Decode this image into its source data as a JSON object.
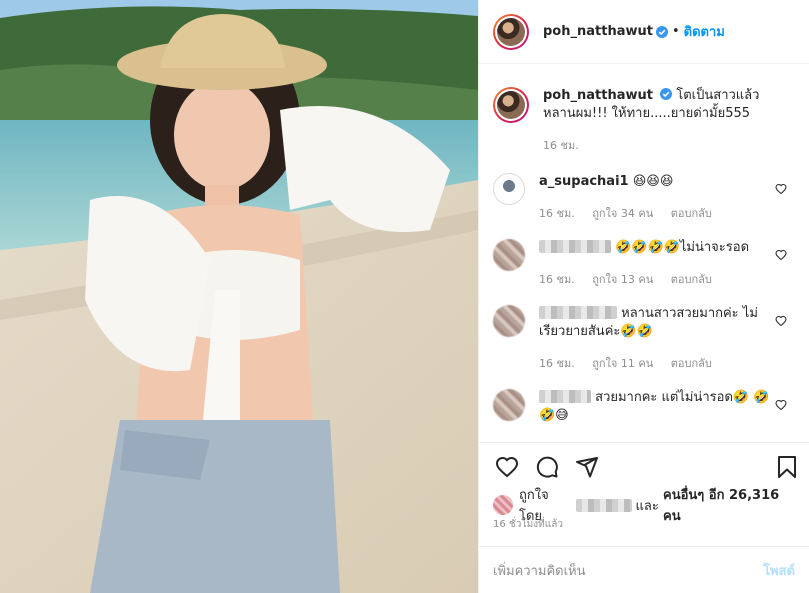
{
  "header": {
    "username": "poh_natthawut",
    "follow_label": "ติดตาม",
    "separator": "•"
  },
  "caption": {
    "username": "poh_natthawut",
    "text": "โตเป็นสาวแล้วหลานผม!!! ให้ทาย.....ยายด่ามั้ย555",
    "time": "16 ชม."
  },
  "comments": [
    {
      "username": "a_supachai1",
      "text": "😆😆😆",
      "time": "16 ชม.",
      "likes": "ถูกใจ 34 คน",
      "reply": "ตอบกลับ"
    },
    {
      "username": "",
      "text": "🤣🤣🤣🤣ไม่น่าจะรอด",
      "time": "16 ชม.",
      "likes": "ถูกใจ 13 คน",
      "reply": "ตอบกลับ"
    },
    {
      "username": "",
      "text": "หลานสาวสวยมากค่ะ ไม่เรียวยายสันค่ะ🤣🤣",
      "time": "16 ชม.",
      "likes": "ถูกใจ 11 คน",
      "reply": "ตอบกลับ"
    },
    {
      "username": "",
      "text": "สวยมากคะ แต่ไม่น่ารอด🤣",
      "text2": "🤣🤣😅",
      "time": "",
      "likes": "",
      "reply": ""
    }
  ],
  "likes": {
    "prefix": "ถูกใจโดย",
    "middle": "และ",
    "others": "คนอื่นๆ อีก 26,316 คน"
  },
  "time_ago": "16 ชั่วโมงที่แล้ว",
  "add_comment": {
    "placeholder": "เพิ่มความคิดเห็น",
    "post_label": "โพสต์"
  },
  "colors": {
    "accent": "#0095f6",
    "verified": "#3897f0",
    "muted": "#8e8e8e"
  },
  "icons": [
    "verified-icon",
    "heart-icon",
    "comment-icon",
    "share-icon",
    "bookmark-icon"
  ]
}
